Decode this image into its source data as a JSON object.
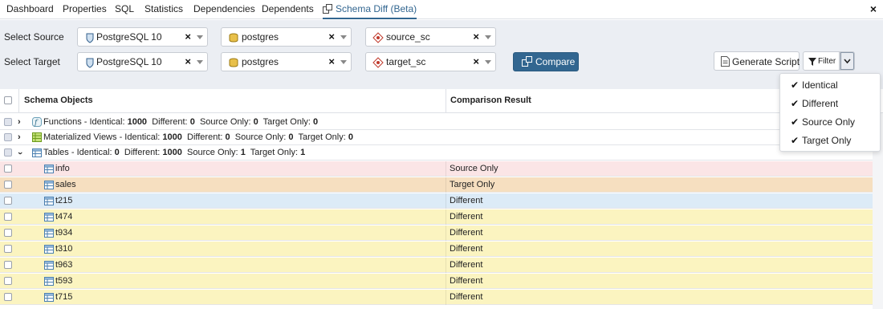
{
  "tabs": [
    {
      "label": "Dashboard"
    },
    {
      "label": "Properties"
    },
    {
      "label": "SQL"
    },
    {
      "label": "Statistics"
    },
    {
      "label": "Dependencies"
    },
    {
      "label": "Dependents"
    },
    {
      "label": "Schema Diff (Beta)"
    }
  ],
  "active_tab": "Schema Diff (Beta)",
  "source": {
    "label": "Select Source",
    "server": "PostgreSQL 10",
    "database": "postgres",
    "schema": "source_sc"
  },
  "target": {
    "label": "Select Target",
    "server": "PostgreSQL 10",
    "database": "postgres",
    "schema": "target_sc"
  },
  "buttons": {
    "compare": "Compare",
    "generate_script": "Generate Script",
    "filter": "Filter"
  },
  "filter_menu": [
    {
      "label": "Identical",
      "checked": true
    },
    {
      "label": "Different",
      "checked": true
    },
    {
      "label": "Source Only",
      "checked": true
    },
    {
      "label": "Target Only",
      "checked": true
    }
  ],
  "table": {
    "headers": {
      "objects": "Schema Objects",
      "result": "Comparison Result"
    },
    "groups": [
      {
        "name": "Functions",
        "expanded": false,
        "identical": "1000",
        "different": "0",
        "source_only": "0",
        "target_only": "0",
        "icon": "functions-icon"
      },
      {
        "name": "Materialized Views",
        "expanded": false,
        "identical": "1000",
        "different": "0",
        "source_only": "0",
        "target_only": "0",
        "icon": "materialized-views-icon"
      },
      {
        "name": "Tables",
        "expanded": true,
        "identical": "0",
        "different": "1000",
        "source_only": "1",
        "target_only": "1",
        "icon": "tables-icon"
      }
    ],
    "group_labels": {
      "identical": "Identical:",
      "different": "Different:",
      "source_only": "Source Only:",
      "target_only": "Target Only:",
      "separator": " - "
    },
    "rows": [
      {
        "name": "info",
        "result": "Source Only",
        "color": "#fbe5e6"
      },
      {
        "name": "sales",
        "result": "Target Only",
        "color": "#f6dfc0"
      },
      {
        "name": "t215",
        "result": "Different",
        "color": "#dcebf7"
      },
      {
        "name": "t474",
        "result": "Different",
        "color": "#fbf4c0"
      },
      {
        "name": "t934",
        "result": "Different",
        "color": "#fbf4c0"
      },
      {
        "name": "t310",
        "result": "Different",
        "color": "#fbf4c0"
      },
      {
        "name": "t963",
        "result": "Different",
        "color": "#fbf4c0"
      },
      {
        "name": "t593",
        "result": "Different",
        "color": "#fbf4c0"
      },
      {
        "name": "t715",
        "result": "Different",
        "color": "#fbf4c0"
      }
    ]
  },
  "colors": {
    "accent": "#326690",
    "controls_bg": "#ebeef3"
  }
}
